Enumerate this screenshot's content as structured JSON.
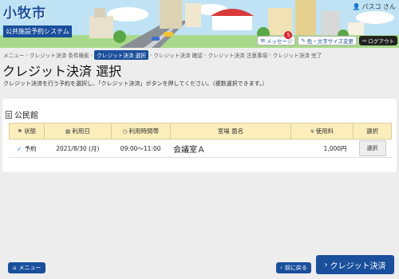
{
  "header": {
    "site_title": "小牧市",
    "site_subtitle": "公共施設予約システム",
    "user_name": "パスコ さん",
    "messages_label": "メッセージ",
    "messages_badge": "5",
    "display_settings_label": "色・文字サイズ変更",
    "logout_label": "ログアウト"
  },
  "breadcrumb": [
    {
      "label": "メニュー"
    },
    {
      "label": "クレジット決済 条件検索"
    },
    {
      "label": "クレジット決済 選択"
    },
    {
      "label": "クレジット決済 確認"
    },
    {
      "label": "クレジット決済 注意事項"
    },
    {
      "label": "クレジット決済 完了"
    }
  ],
  "page": {
    "title": "クレジット決済 選択",
    "description": "クレジット決済を行う予約を選択し、「クレジット決済」ボタンを押してください。（複数選択できます。）"
  },
  "facility": {
    "name": "公民館",
    "columns": {
      "status": "状態",
      "date": "利用日",
      "time": "利用時間帯",
      "room": "室場 面名",
      "fee": "使用料",
      "select": "選択"
    },
    "rows": [
      {
        "status": "予約",
        "date": "2021/8/30 (月)",
        "time": "09:00～11:00",
        "room": "会議室Ａ",
        "fee": "1,000円",
        "select_label": "選択"
      }
    ]
  },
  "footer": {
    "menu_label": "メニュー",
    "back_label": "前に戻る",
    "pay_label": "クレジット決済"
  },
  "colors": {
    "brand": "#1a4f9c",
    "table_header": "#fbeebb"
  }
}
